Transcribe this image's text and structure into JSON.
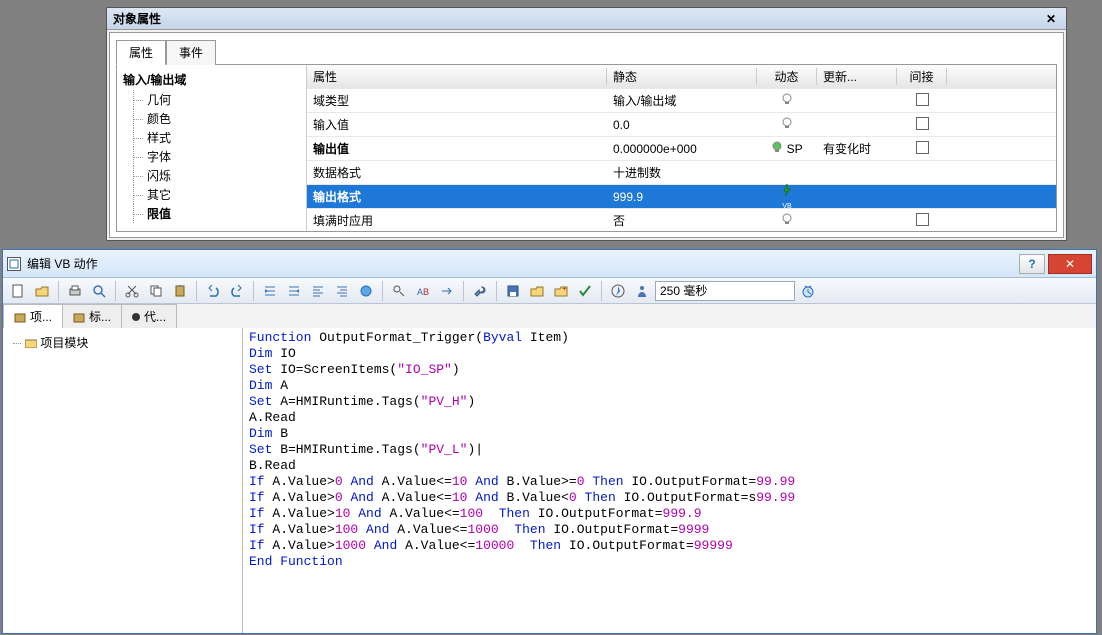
{
  "props": {
    "title": "对象属性",
    "tabs": {
      "attr": "属性",
      "evt": "事件"
    },
    "tree": {
      "root": "输入/输出域",
      "items": [
        "几何",
        "颜色",
        "样式",
        "字体",
        "闪烁",
        "其它",
        "限值"
      ]
    },
    "table": {
      "headers": {
        "attr": "属性",
        "static": "静态",
        "dyn": "动态",
        "update": "更新...",
        "indirect": "间接"
      },
      "rows": [
        {
          "attr": "域类型",
          "static": "输入/输出域",
          "dyn": "bulb",
          "update": "",
          "indirect": true,
          "bold": false
        },
        {
          "attr": "输入值",
          "static": "0.0",
          "dyn": "bulb",
          "update": "",
          "indirect": true,
          "bold": false
        },
        {
          "attr": "输出值",
          "static": "0.000000e+000",
          "dyn": "bulb-green",
          "dyn_text": "SP",
          "update": "有变化时",
          "indirect": true,
          "bold": true
        },
        {
          "attr": "数据格式",
          "static": "十进制数",
          "dyn": "",
          "update": "",
          "indirect": false,
          "bold": false
        },
        {
          "attr": "输出格式",
          "static": "999.9",
          "dyn": "vb-bolt",
          "update": "",
          "indirect": false,
          "bold": true,
          "selected": true
        },
        {
          "attr": "填满时应用",
          "static": "否",
          "dyn": "bulb",
          "update": "",
          "indirect": true,
          "bold": false
        }
      ]
    }
  },
  "vb": {
    "title": "编辑 VB 动作",
    "toolbar_text": "250 毫秒",
    "tabs2": {
      "proj": "项...",
      "mark": "标...",
      "rep": "代..."
    },
    "tree_root": "项目模块",
    "code": {
      "lines": [
        [
          [
            "kw",
            "Function"
          ],
          [
            "ident",
            " OutputFormat_Trigger("
          ],
          [
            "kw",
            "Byval"
          ],
          [
            "ident",
            " Item)"
          ]
        ],
        [
          [
            "kw",
            "Dim"
          ],
          [
            "ident",
            " IO"
          ]
        ],
        [
          [
            "kw",
            "Set"
          ],
          [
            "ident",
            " IO=ScreenItems("
          ],
          [
            "str",
            "\"IO_SP\""
          ],
          [
            "ident",
            ")"
          ]
        ],
        [
          [
            "kw",
            "Dim"
          ],
          [
            "ident",
            " A"
          ]
        ],
        [
          [
            "kw",
            "Set"
          ],
          [
            "ident",
            " A=HMIRuntime.Tags("
          ],
          [
            "str",
            "\"PV_H\""
          ],
          [
            "ident",
            ")"
          ]
        ],
        [
          [
            "ident",
            "A.Read"
          ]
        ],
        [
          [
            "kw",
            "Dim"
          ],
          [
            "ident",
            " B"
          ]
        ],
        [
          [
            "kw",
            "Set"
          ],
          [
            "ident",
            " B=HMIRuntime.Tags("
          ],
          [
            "str",
            "\"PV_L\""
          ],
          [
            "ident",
            ")|"
          ]
        ],
        [
          [
            "ident",
            "B.Read"
          ]
        ],
        [
          [
            "kw",
            "If"
          ],
          [
            "ident",
            " A.Value>"
          ],
          [
            "num",
            "0"
          ],
          [
            "ident",
            " "
          ],
          [
            "kw",
            "And"
          ],
          [
            "ident",
            " A.Value<="
          ],
          [
            "num",
            "10"
          ],
          [
            "ident",
            " "
          ],
          [
            "kw",
            "And"
          ],
          [
            "ident",
            " B.Value>="
          ],
          [
            "num",
            "0"
          ],
          [
            "ident",
            " "
          ],
          [
            "kw",
            "Then"
          ],
          [
            "ident",
            " IO.OutputFormat="
          ],
          [
            "num",
            "99.99"
          ]
        ],
        [
          [
            "kw",
            "If"
          ],
          [
            "ident",
            " A.Value>"
          ],
          [
            "num",
            "0"
          ],
          [
            "ident",
            " "
          ],
          [
            "kw",
            "And"
          ],
          [
            "ident",
            " A.Value<="
          ],
          [
            "num",
            "10"
          ],
          [
            "ident",
            " "
          ],
          [
            "kw",
            "And"
          ],
          [
            "ident",
            " B.Value<"
          ],
          [
            "num",
            "0"
          ],
          [
            "ident",
            " "
          ],
          [
            "kw",
            "Then"
          ],
          [
            "ident",
            " IO.OutputFormat=s"
          ],
          [
            "num",
            "99.99"
          ]
        ],
        [
          [
            "kw",
            "If"
          ],
          [
            "ident",
            " A.Value>"
          ],
          [
            "num",
            "10"
          ],
          [
            "ident",
            " "
          ],
          [
            "kw",
            "And"
          ],
          [
            "ident",
            " A.Value<="
          ],
          [
            "num",
            "100"
          ],
          [
            "ident",
            "  "
          ],
          [
            "kw",
            "Then"
          ],
          [
            "ident",
            " IO.OutputFormat="
          ],
          [
            "num",
            "999.9"
          ]
        ],
        [
          [
            "kw",
            "If"
          ],
          [
            "ident",
            " A.Value>"
          ],
          [
            "num",
            "100"
          ],
          [
            "ident",
            " "
          ],
          [
            "kw",
            "And"
          ],
          [
            "ident",
            " A.Value<="
          ],
          [
            "num",
            "1000"
          ],
          [
            "ident",
            "  "
          ],
          [
            "kw",
            "Then"
          ],
          [
            "ident",
            " IO.OutputFormat="
          ],
          [
            "num",
            "9999"
          ]
        ],
        [
          [
            "kw",
            "If"
          ],
          [
            "ident",
            " A.Value>"
          ],
          [
            "num",
            "1000"
          ],
          [
            "ident",
            " "
          ],
          [
            "kw",
            "And"
          ],
          [
            "ident",
            " A.Value<="
          ],
          [
            "num",
            "10000"
          ],
          [
            "ident",
            "  "
          ],
          [
            "kw",
            "Then"
          ],
          [
            "ident",
            " IO.OutputFormat="
          ],
          [
            "num",
            "99999"
          ]
        ],
        [
          [
            "kw",
            "End Function"
          ]
        ]
      ]
    }
  }
}
